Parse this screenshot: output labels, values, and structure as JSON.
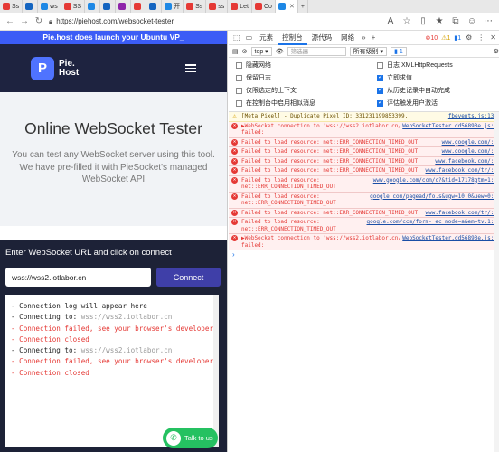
{
  "browser": {
    "tabs": [
      {
        "label": "Ss",
        "color": "#e53935"
      },
      {
        "label": "",
        "color": "#1565c0"
      },
      {
        "label": "ws",
        "color": "#1e88e5"
      },
      {
        "label": "SS",
        "color": "#e53935"
      },
      {
        "label": "",
        "color": "#1e88e5"
      },
      {
        "label": "",
        "color": "#1565c0"
      },
      {
        "label": "",
        "color": "#8e24aa"
      },
      {
        "label": "",
        "color": "#e53935"
      },
      {
        "label": "",
        "color": "#1565c0"
      },
      {
        "label": "开",
        "color": "#1e88e5"
      },
      {
        "label": "Ss",
        "color": "#e53935"
      },
      {
        "label": "ss",
        "color": "#e53935"
      },
      {
        "label": "Let",
        "color": "#e53935"
      },
      {
        "label": "Co",
        "color": "#e53935"
      },
      {
        "label": "",
        "color": "#1e88e5"
      }
    ],
    "url": "https://piehost.com/websocket-tester"
  },
  "page": {
    "banner": "Pie.host does launch your Ubuntu VP_",
    "logo_mark": "P",
    "logo_line1": "Pie.",
    "logo_line2": "Host",
    "hero_title": "Online WebSocket Tester",
    "hero_text": "You can test any WebSocket server using this tool. We have pre-filled it with PieSocket's managed WebSocket API",
    "tester_heading": "Enter WebSocket URL and click on connect",
    "ws_url": "wss://wss2.iotlabor.cn",
    "connect_label": "Connect",
    "log": [
      {
        "prefix": "- Connection log will appear here",
        "rest": "",
        "kind": "normal"
      },
      {
        "prefix": "- Connecting to: ",
        "rest": "wss://wss2.iotlabor.cn",
        "kind": "connecting"
      },
      {
        "prefix": "- Connection failed, see your browser's developer",
        "rest": "",
        "kind": "error"
      },
      {
        "prefix": "- Connection closed",
        "rest": "",
        "kind": "error"
      },
      {
        "prefix": "- Connecting to: ",
        "rest": "wss://wss2.iotlabor.cn",
        "kind": "connecting"
      },
      {
        "prefix": "- Connection failed, see your browser's developer",
        "rest": "",
        "kind": "error"
      },
      {
        "prefix": "- Connection closed",
        "rest": "",
        "kind": "error"
      }
    ],
    "whatsapp_label": "Talk to us"
  },
  "devtools": {
    "tabs": [
      "元素",
      "控制台",
      "源代码",
      "网络"
    ],
    "active_tab": "控制台",
    "error_count": "10",
    "warning_count": "1",
    "info_count": "1",
    "context": "top",
    "filter_placeholder": "筛选器",
    "level": "所有级别",
    "issues": "1",
    "settings_left": [
      "隐藏网络",
      "保留日志",
      "仅限选定的上下文",
      "在控制台中启用相似消息"
    ],
    "settings_right": [
      "日志 XMLHttpRequests",
      "立即求值",
      "从历史记录中自动完成",
      "评估触发用户激活"
    ],
    "settings_right_checked": [
      false,
      true,
      true,
      true
    ],
    "messages": [
      {
        "type": "warn",
        "text": "[Meta Pixel] - Duplicate Pixel ID: 331231199853399.",
        "source": "fbevents.js:134"
      },
      {
        "type": "error",
        "text": "▶WebSocket connection to 'wss://wss2.iotlabor.cn/'\nfailed:",
        "source": "WebSocketTester.dd56893e.js:1"
      },
      {
        "type": "error",
        "text": "Failed to load resource: net::ERR_CONNECTION_TIMED_OUT",
        "source": "www.google.com/:1"
      },
      {
        "type": "error",
        "text": "Failed to load resource: net::ERR_CONNECTION_TIMED_OUT",
        "source": "www.google.com/:1"
      },
      {
        "type": "error",
        "text": "Failed to load resource: net::ERR_CONNECTION_TIMED_OUT",
        "source": "www.facebook.com/:1"
      },
      {
        "type": "error",
        "text": "Failed to load resource: net::ERR_CONNECTION_TIMED_OUT",
        "source": "www.facebook.com/tr/:1"
      },
      {
        "type": "error",
        "text": "Failed to load resource:\nnet::ERR_CONNECTION_TIMED_OUT",
        "source": "www.google.com/ccm/c?&tid=17178gtm=1:1"
      },
      {
        "type": "error",
        "text": "Failed to load resource:\nnet::ERR_CONNECTION_TIMED_OUT",
        "source": "google.com/pagead/fo.s&ugw=10.0&uew=0:1"
      },
      {
        "type": "error",
        "text": "Failed to load resource: net::ERR_CONNECTION_TIMED_OUT",
        "source": "www.facebook.com/tr/:1"
      },
      {
        "type": "error",
        "text": "Failed to load resource:\nnet::ERR_CONNECTION_TIMED_OUT",
        "source": "google.com/ccm/form-_ec_mode=a&em=tv.1:1"
      },
      {
        "type": "error",
        "text": "▶WebSocket connection to 'wss://wss2.iotlabor.cn/'\nfailed:",
        "source": "WebSocketTester.dd56893e.js:1"
      }
    ],
    "prompt": "›"
  }
}
